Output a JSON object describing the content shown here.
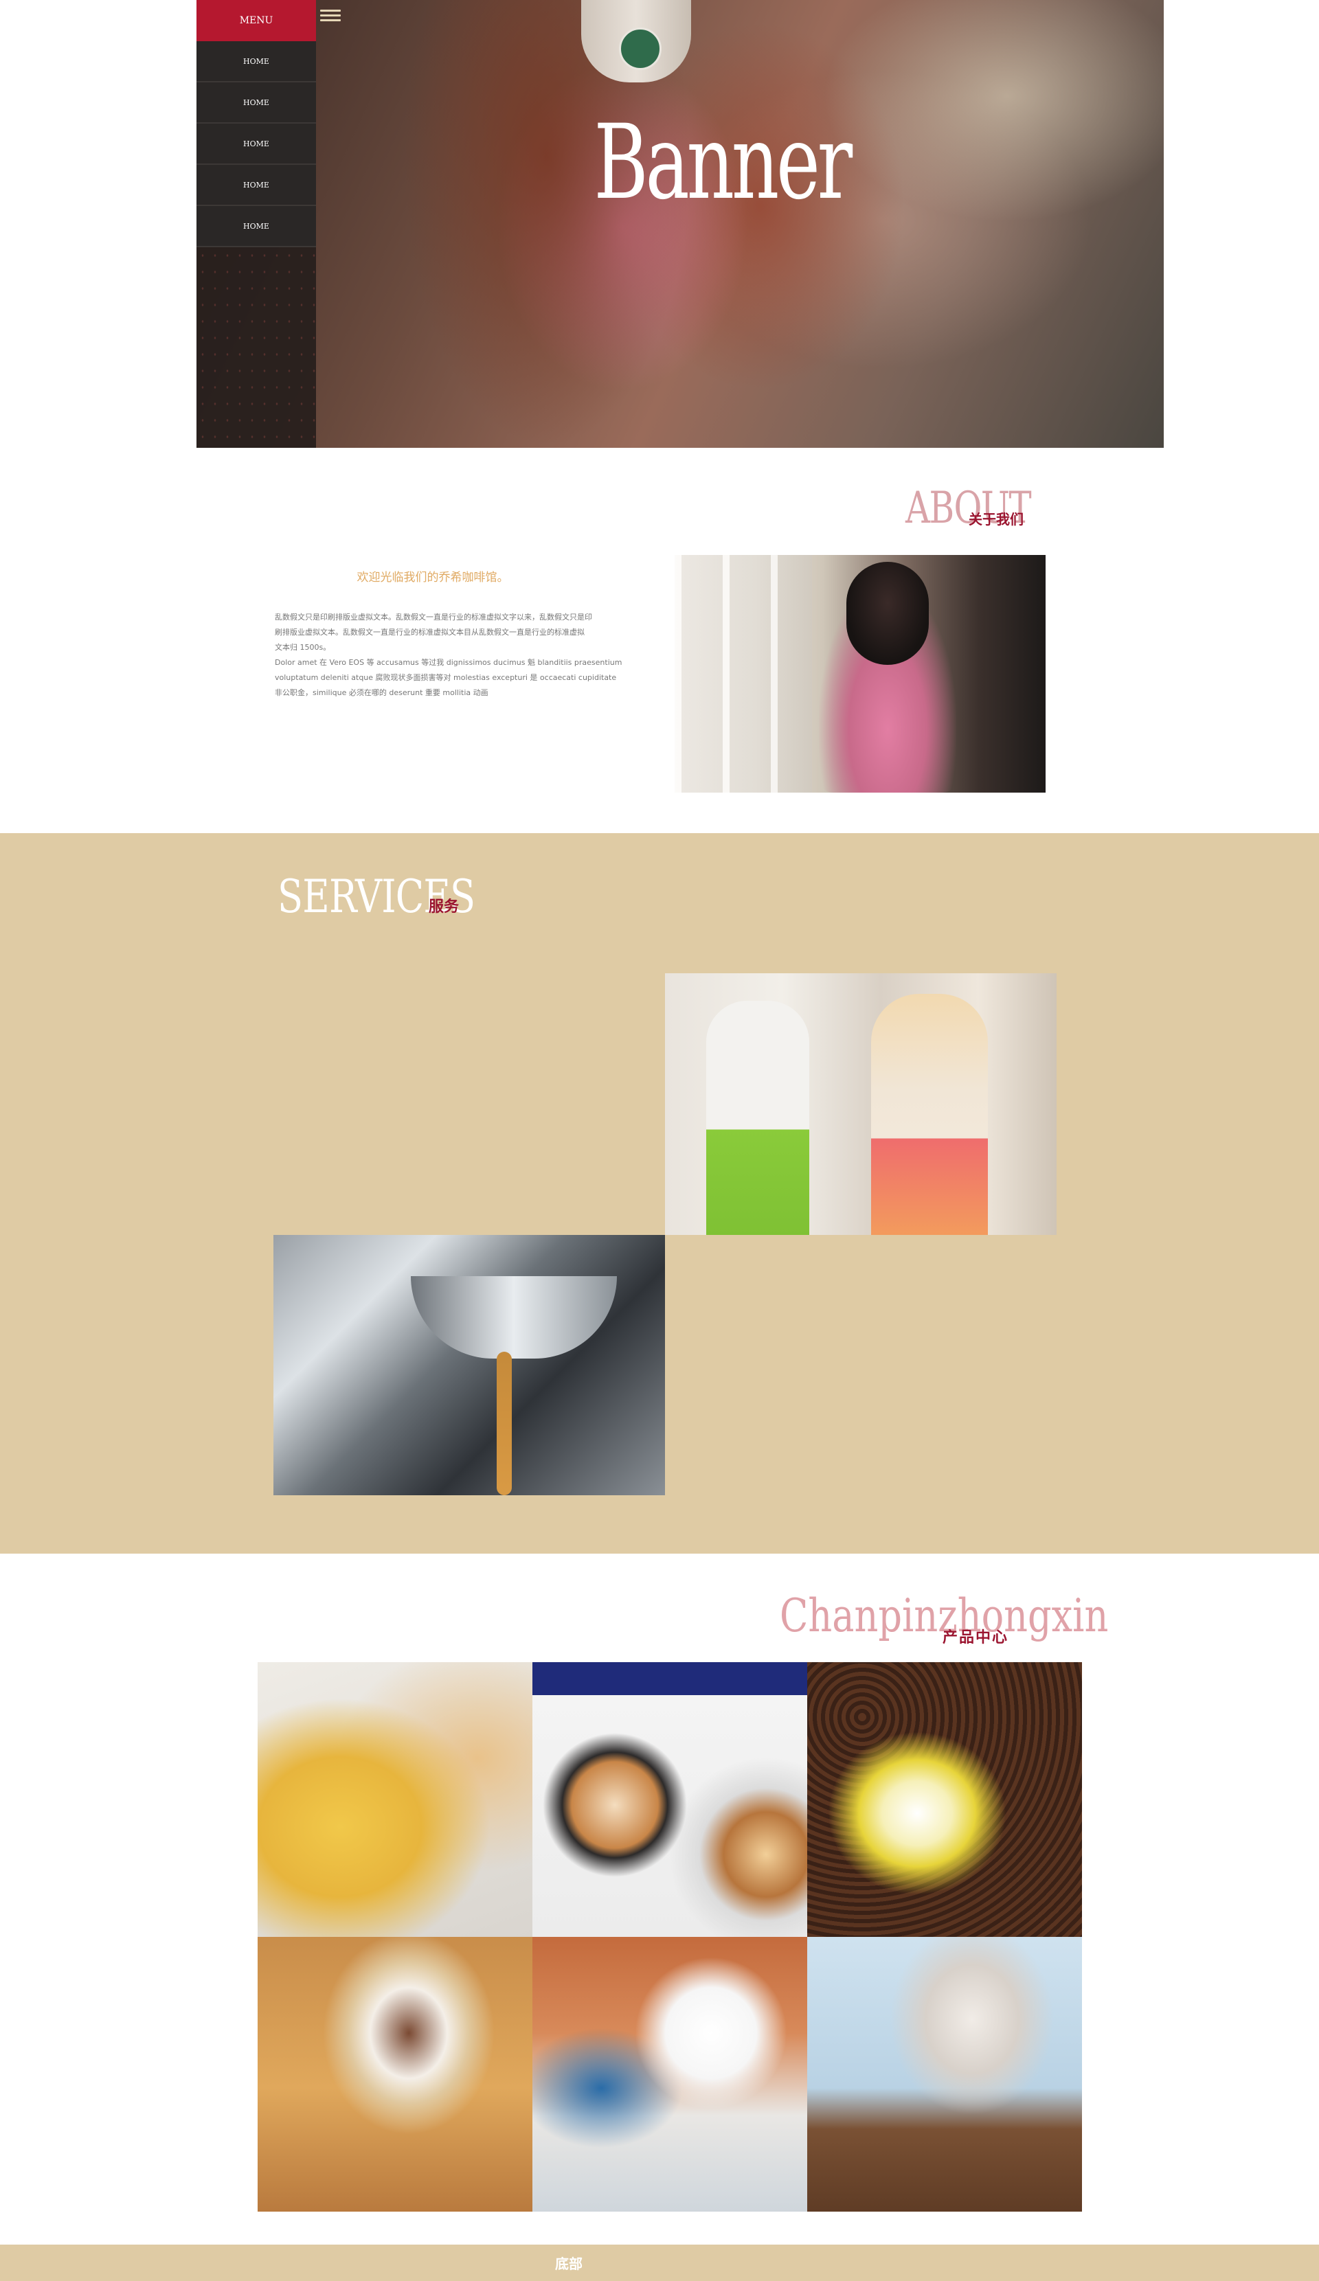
{
  "nav": {
    "menu_label": "MENU",
    "items": [
      "HOME",
      "HOME",
      "HOME",
      "HOME",
      "HOME"
    ]
  },
  "hero": {
    "title": "Banner"
  },
  "about": {
    "title_en": "ABOUT",
    "title_cn": "关于我们",
    "welcome": "欢迎光临我们的乔希咖啡馆。",
    "body": [
      "乱数假文只是印刷排版业虚拟文本。乱数假文一直是行业的标准虚拟文字以来，乱数假文只是印",
      "刷排版业虚拟文本。乱数假文一直是行业的标准虚拟文本目从乱数假文一直是行业的标准虚拟",
      "文本归 1500s。",
      "Dolor amet 在 Vero EOS 等 accusamus 等过我 dignissimos ducimus 魁 blanditiis praesentium",
      " voluptatum deleniti atque 腐败现状多面损害等对 molestias excepturi 是 occaecati cupiditate",
      "非公职金，similique 必须在哪的 deserunt 重要 mollitia 动画"
    ]
  },
  "services": {
    "title_en": "SERVICES",
    "title_cn": "服务"
  },
  "products": {
    "title_en": "Chanpinzhongxin",
    "title_cn": "产品中心"
  },
  "footer": {
    "text": "底部"
  },
  "colors": {
    "menu_accent": "#b5182f",
    "section_bg": "#dfcba4",
    "title_pink": "#d9a3a8",
    "subtitle_red": "#9b1530",
    "welcome_orange": "#e0aa63"
  }
}
